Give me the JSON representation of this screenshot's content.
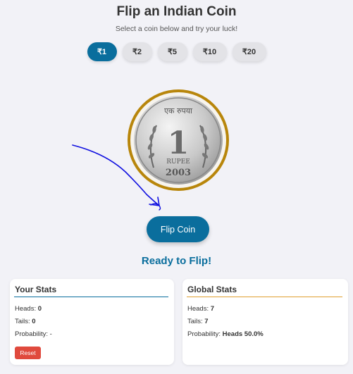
{
  "header": {
    "title": "Flip an Indian Coin",
    "subtitle": "Select a coin below and try your luck!"
  },
  "coins": [
    {
      "label": "₹1",
      "active": true
    },
    {
      "label": "₹2",
      "active": false
    },
    {
      "label": "₹5",
      "active": false
    },
    {
      "label": "₹10",
      "active": false
    },
    {
      "label": "₹20",
      "active": false
    }
  ],
  "coin_face": {
    "script_text": "एक रुपया",
    "numeral": "1",
    "denomination": "RUPEE",
    "year": "2003"
  },
  "flip_button": "Flip Coin",
  "status": "Ready to Flip!",
  "your_stats": {
    "title": "Your Stats",
    "heads_label": "Heads:",
    "heads": "0",
    "tails_label": "Tails:",
    "tails": "0",
    "probability_label": "Probability:",
    "probability": "-",
    "reset": "Reset"
  },
  "global_stats": {
    "title": "Global Stats",
    "heads_label": "Heads:",
    "heads": "7",
    "tails_label": "Tails:",
    "tails": "7",
    "probability_label": "Probability:",
    "probability": "Heads 50.0%"
  },
  "colors": {
    "accent": "#0a6e9d",
    "global_accent": "#e0a030",
    "reset": "#e04a3d",
    "coin_rim": "#b8860b",
    "annotation": "#1010e0"
  }
}
